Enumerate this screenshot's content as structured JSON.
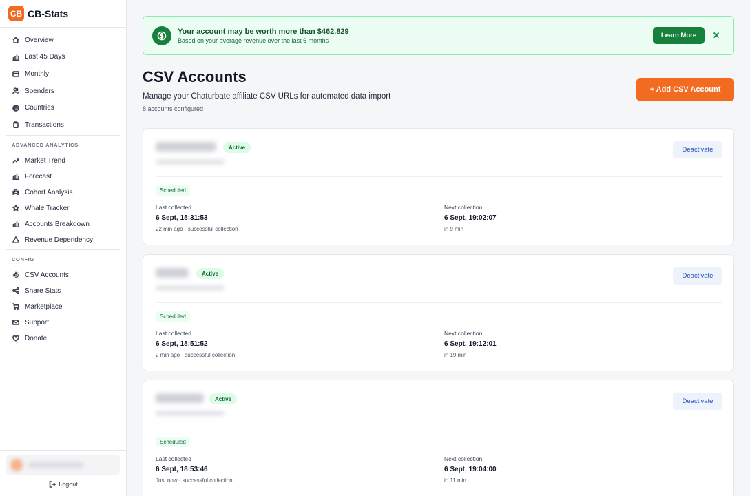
{
  "brand": {
    "logo": "CB",
    "name": "CB-Stats"
  },
  "nav": {
    "main": [
      {
        "label": "Overview",
        "icon": "home-icon"
      },
      {
        "label": "Last 45 Days",
        "icon": "bar-chart-icon"
      },
      {
        "label": "Monthly",
        "icon": "calendar-icon"
      },
      {
        "label": "Spenders",
        "icon": "users-icon"
      },
      {
        "label": "Countries",
        "icon": "globe-icon"
      },
      {
        "label": "Transactions",
        "icon": "clipboard-icon"
      }
    ],
    "advanced_title": "ADVANCED ANALYTICS",
    "advanced": [
      {
        "label": "Market Trend",
        "icon": "trend-icon"
      },
      {
        "label": "Forecast",
        "icon": "bar-chart-icon"
      },
      {
        "label": "Cohort Analysis",
        "icon": "cohort-icon"
      },
      {
        "label": "Whale Tracker",
        "icon": "star-icon"
      },
      {
        "label": "Accounts Breakdown",
        "icon": "bar-chart-icon"
      },
      {
        "label": "Revenue Dependency",
        "icon": "warning-icon"
      }
    ],
    "config_title": "CONFIG",
    "config": [
      {
        "label": "CSV Accounts",
        "icon": "gear-icon"
      },
      {
        "label": "Share Stats",
        "icon": "share-icon"
      },
      {
        "label": "Marketplace",
        "icon": "cart-icon"
      },
      {
        "label": "Support",
        "icon": "mail-icon"
      },
      {
        "label": "Donate",
        "icon": "heart-icon"
      }
    ],
    "logout": "Logout"
  },
  "banner": {
    "title": "Your account may be worth more than $462,829",
    "subtitle": "Based on your average revenue over the last 6 months",
    "button": "Learn More"
  },
  "page": {
    "title": "CSV Accounts",
    "description": "Manage your Chaturbate affiliate CSV URLs for automated data import",
    "count": "8 accounts configured",
    "add_button": "+ Add CSV Account"
  },
  "labels": {
    "last_collected": "Last collected",
    "next_collection": "Next collection",
    "deactivate": "Deactivate"
  },
  "accounts": [
    {
      "status": "Active",
      "schedule": "Scheduled",
      "last_collected": "6 Sept, 18:31:53",
      "last_note": "22 min ago · successful collection",
      "next_collection": "6 Sept, 19:02:07",
      "next_note": "in 9 min"
    },
    {
      "status": "Active",
      "schedule": "Scheduled",
      "last_collected": "6 Sept, 18:51:52",
      "last_note": "2 min ago · successful collection",
      "next_collection": "6 Sept, 19:12:01",
      "next_note": "in 19 min"
    },
    {
      "status": "Active",
      "schedule": "Scheduled",
      "last_collected": "6 Sept, 18:53:46",
      "last_note": "Just now · successful collection",
      "next_collection": "6 Sept, 19:04:00",
      "next_note": "in 11 min"
    }
  ],
  "colors": {
    "brand": "#f26b21",
    "success": "#16803c",
    "link": "#2453b8"
  }
}
